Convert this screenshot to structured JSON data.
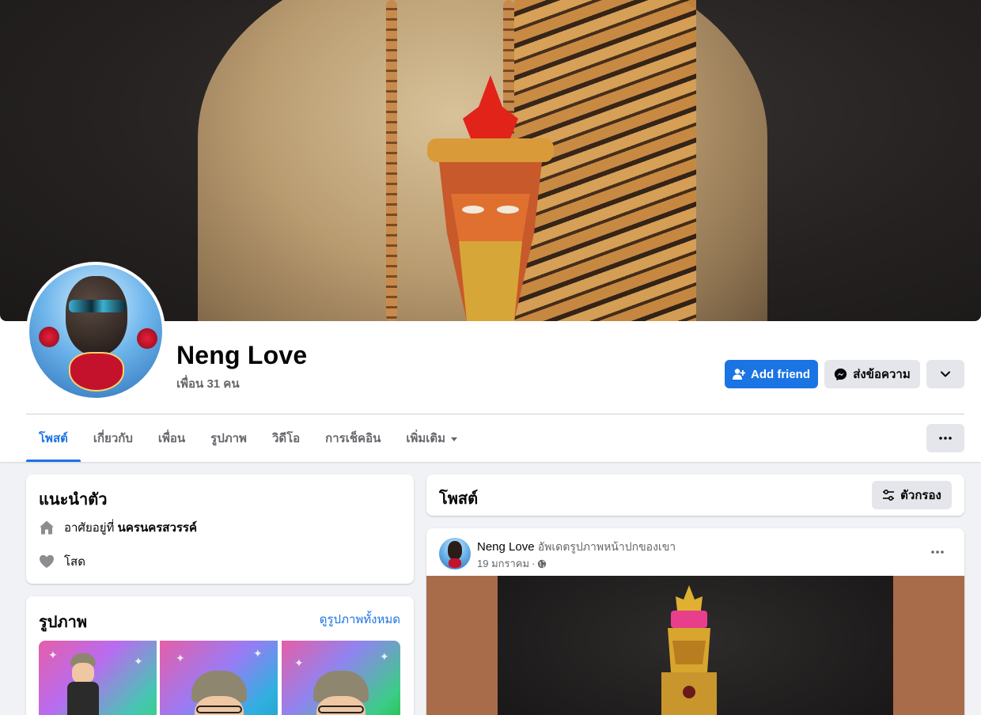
{
  "profile": {
    "name": "Neng Love",
    "friends": "เพื่อน 31 คน"
  },
  "actions": {
    "add_friend": "Add friend",
    "message": "ส่งข้อความ"
  },
  "tabs": [
    {
      "label": "โพสต์"
    },
    {
      "label": "เกี่ยวกับ"
    },
    {
      "label": "เพื่อน"
    },
    {
      "label": "รูปภาพ"
    },
    {
      "label": "วิดีโอ"
    },
    {
      "label": "การเช็คอิน"
    },
    {
      "label": "เพิ่มเติม"
    }
  ],
  "intro": {
    "title": "แนะนำตัว",
    "lives_prefix": "อาศัยอยู่ที่",
    "lives_place": "นครนครสวรรค์",
    "relationship": "โสด"
  },
  "photos": {
    "title": "รูปภาพ",
    "see_all": "ดูรูปภาพทั้งหมด"
  },
  "posts": {
    "title": "โพสต์",
    "filter": "ตัวกรอง"
  },
  "post": {
    "author": "Neng Love",
    "action": "อัพเดตรูปภาพหน้าปกของเขา",
    "date": "19 มกราคม",
    "separator": "·"
  },
  "colors": {
    "accent": "#1b74e4",
    "background": "#f0f2f5",
    "secondary_button": "#e4e6eb"
  }
}
